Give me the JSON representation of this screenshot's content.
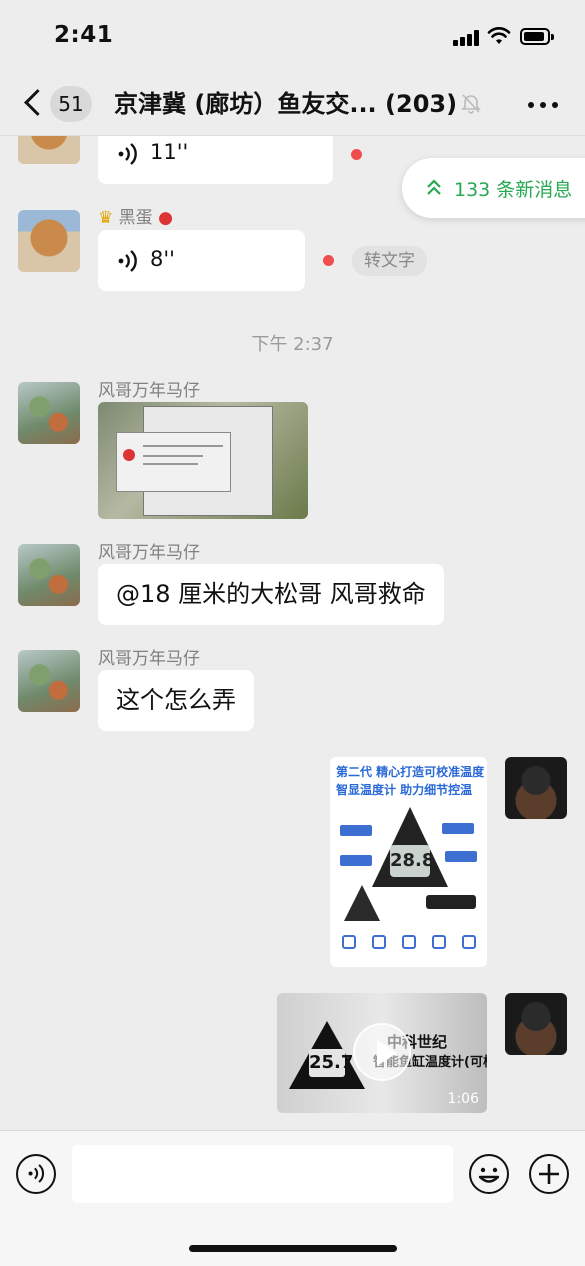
{
  "status_bar": {
    "time": "2:41"
  },
  "nav": {
    "unread_count": "51",
    "title": "京津冀 (廊坊）鱼友交... (203)"
  },
  "new_messages": {
    "label": "133 条新消息"
  },
  "messages": {
    "voice1": {
      "duration": "11''"
    },
    "voice2": {
      "sender": "黑蛋",
      "duration": "8''",
      "to_text_label": "转文字"
    },
    "time_divider": "下午 2:37",
    "m3": {
      "sender": "风哥万年马仔"
    },
    "m4": {
      "sender": "风哥万年马仔",
      "text": "@18 厘米的大松哥 风哥救命"
    },
    "m5": {
      "sender": "风哥万年马仔",
      "text": "这个怎么弄"
    },
    "product_image": {
      "title_line1": "第二代 精心打造可校准温度",
      "title_line2": "智显温度计 助力细节控温",
      "display_value": "28.8"
    },
    "video": {
      "title_line1": "中科世纪",
      "title_line2": "智能鱼缸温度计(可校准)",
      "display_value": "25.7",
      "duration": "1:06"
    }
  },
  "colors": {
    "accent_green": "#27a852",
    "unread_dot": "#f04e4e",
    "chat_bg": "#ededed"
  }
}
